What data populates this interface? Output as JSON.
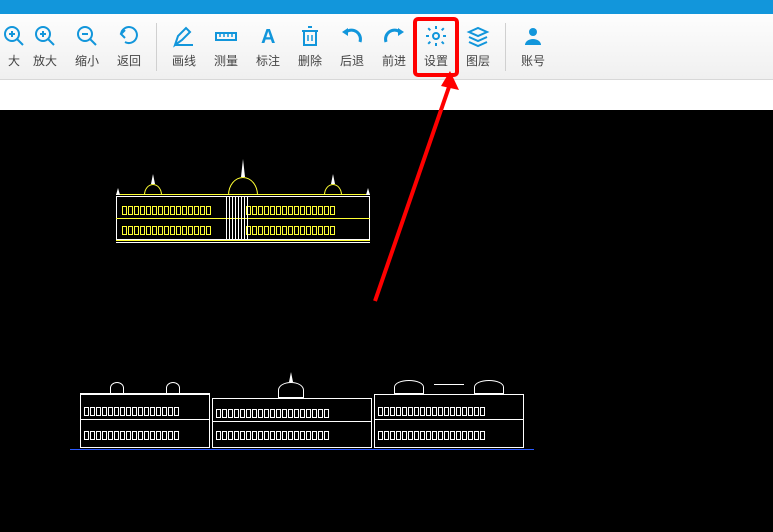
{
  "toolbar": {
    "items": [
      {
        "id": "zoom-fit",
        "label": "大",
        "icon": "zoom-in",
        "partial": true
      },
      {
        "id": "zoom-in",
        "label": "放大",
        "icon": "zoom-in"
      },
      {
        "id": "zoom-out",
        "label": "缩小",
        "icon": "zoom-out"
      },
      {
        "id": "back",
        "label": "返回",
        "icon": "return"
      },
      {
        "id": "draw-line",
        "label": "画线",
        "icon": "pencil"
      },
      {
        "id": "measure",
        "label": "测量",
        "icon": "ruler"
      },
      {
        "id": "annotate",
        "label": "标注",
        "icon": "text-a"
      },
      {
        "id": "delete",
        "label": "删除",
        "icon": "trash"
      },
      {
        "id": "undo",
        "label": "后退",
        "icon": "undo"
      },
      {
        "id": "redo",
        "label": "前进",
        "icon": "redo"
      },
      {
        "id": "settings",
        "label": "设置",
        "icon": "gear",
        "highlighted": true
      },
      {
        "id": "layers",
        "label": "图层",
        "icon": "layers"
      },
      {
        "id": "account",
        "label": "账号",
        "icon": "user"
      }
    ],
    "separators_after": [
      3,
      11
    ]
  },
  "canvas": {
    "background": "#000000",
    "drawings": [
      {
        "name": "building-elevation-top",
        "style": "yellow-white-outline"
      },
      {
        "name": "building-elevation-bottom",
        "style": "white-outline"
      }
    ]
  },
  "annotation": {
    "type": "arrow",
    "color": "#ff0000",
    "target": "settings"
  }
}
